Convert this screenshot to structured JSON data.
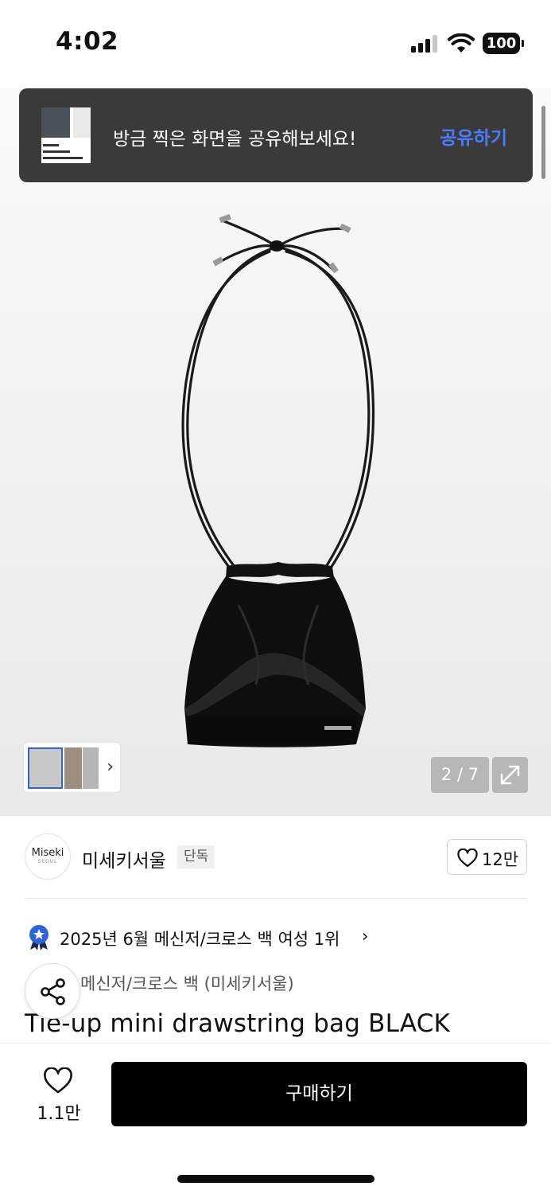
{
  "status_bar": {
    "time": "4:02",
    "battery": "100"
  },
  "share_banner": {
    "message": "방금 찍은 화면을 공유해보세요!",
    "action": "공유하기"
  },
  "gallery": {
    "counter": "2 / 7"
  },
  "brand": {
    "logo_text": "Miseki",
    "logo_sub": "SEOUL",
    "name": "미세키서울",
    "badge": "단독",
    "likes": "12만"
  },
  "ranking": {
    "text": "2025년 6월 메신저/크로스 백 여성 1위",
    "chevron": "›"
  },
  "product": {
    "category": "메신저/크로스 백 (미세키서울)",
    "title": "Tie-up mini drawstring bag BLACK"
  },
  "bottom_bar": {
    "wish_count": "1.1만",
    "buy_label": "구매하기"
  },
  "colors": {
    "accent_blue": "#4b7bff",
    "badge_blue": "#2f63d8",
    "buy_bg": "#000000"
  }
}
